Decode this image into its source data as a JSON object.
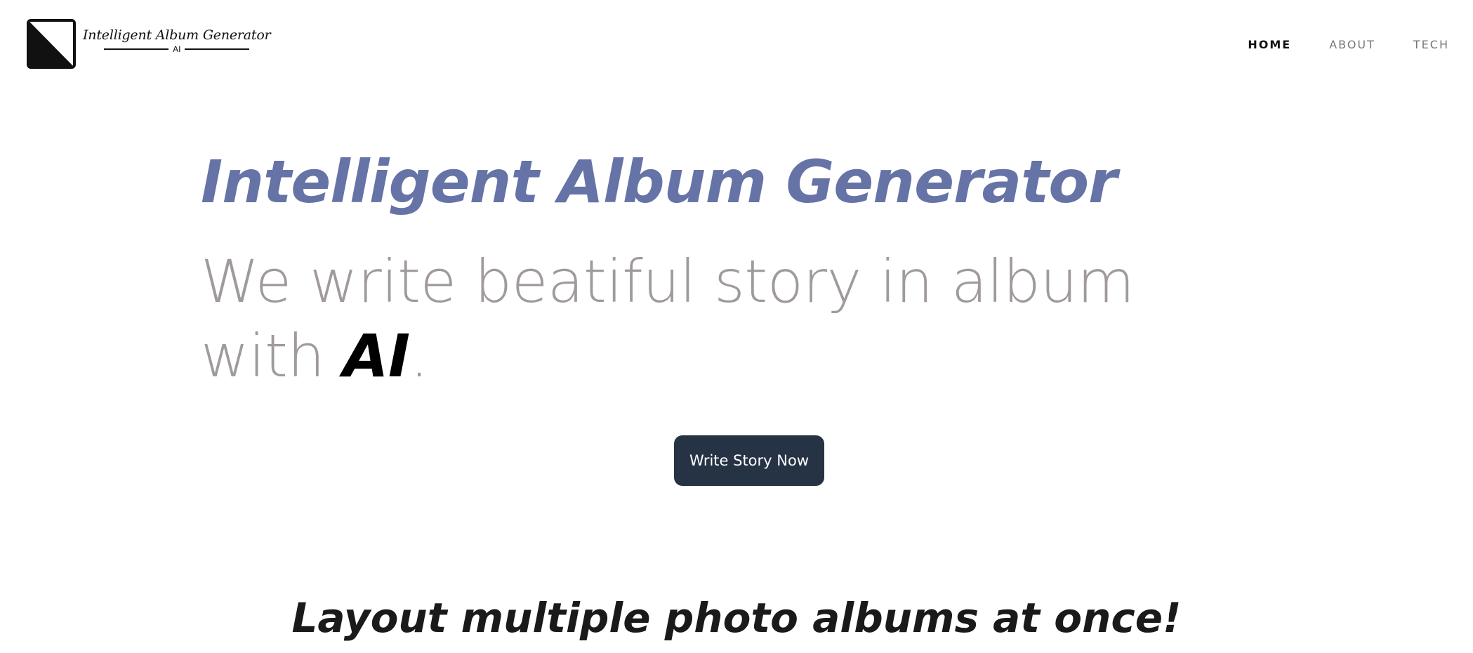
{
  "logo": {
    "title": "Intelligent Album Generator",
    "subtitle": "AI",
    "icon": "diagonal-square-logo-icon"
  },
  "nav": {
    "items": [
      {
        "label": "HOME",
        "active": true
      },
      {
        "label": "ABOUT",
        "active": false
      },
      {
        "label": "TECH",
        "active": false
      }
    ]
  },
  "hero": {
    "title": "Intelligent Album Generator",
    "subtitle_line1": "We write beatiful story in album",
    "subtitle_line2_prefix": "with ",
    "subtitle_emphasis": "AI",
    "subtitle_suffix": "."
  },
  "cta": {
    "label": "Write Story Now"
  },
  "section": {
    "heading": "Layout multiple photo albums at once!"
  },
  "colors": {
    "hero_title": "#6673a6",
    "hero_subtitle": "#a09a9b",
    "button_bg": "#253345",
    "text_dark": "#111111"
  }
}
